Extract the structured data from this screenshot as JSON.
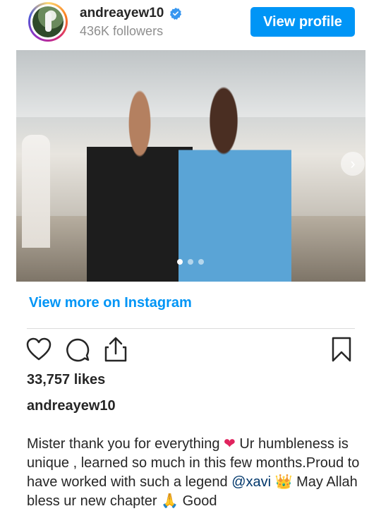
{
  "header": {
    "username": "andreayew10",
    "followers": "436K followers",
    "view_profile_label": "View profile"
  },
  "post": {
    "carousel": {
      "total_slides": 3,
      "active_slide": 1
    },
    "view_more_label": "View more on Instagram",
    "likes": "33,757 likes",
    "caption_user": "andreayew10",
    "caption_lines": [
      "Mister thank you for everything",
      "Ur humbleness is unique , learned so much in this few months.Proud to have worked with such a legend",
      "@xavi",
      "May Allah bless ur new chapter",
      "Good"
    ]
  },
  "colors": {
    "accent": "#0095f6",
    "text": "#262626",
    "secondary": "#8e8e8e",
    "divider": "#dbdbdb",
    "heart": "#e0245e"
  },
  "icons": {
    "like": "heart-outline-icon",
    "comment": "comment-bubble-icon",
    "share": "share-upload-icon",
    "save": "bookmark-icon",
    "verified": "verified-badge-icon",
    "next": "chevron-right-icon"
  }
}
